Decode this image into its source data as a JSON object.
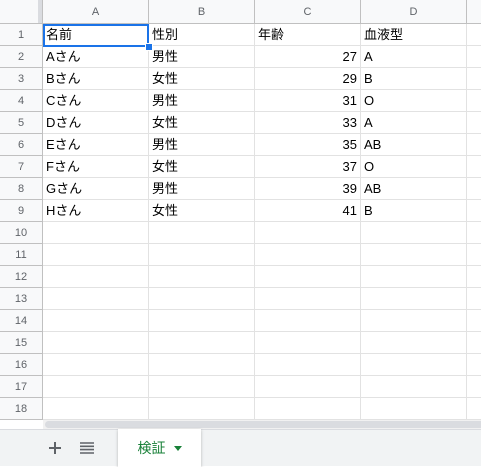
{
  "columns": [
    "A",
    "B",
    "C",
    "D"
  ],
  "rows": [
    "1",
    "2",
    "3",
    "4",
    "5",
    "6",
    "7",
    "8",
    "9",
    "10",
    "11",
    "12",
    "13",
    "14",
    "15",
    "16",
    "17",
    "18"
  ],
  "table": {
    "header": [
      "名前",
      "性別",
      "年齢",
      "血液型"
    ],
    "data": [
      [
        "Aさん",
        "男性",
        "27",
        "A"
      ],
      [
        "Bさん",
        "女性",
        "29",
        "B"
      ],
      [
        "Cさん",
        "男性",
        "31",
        "O"
      ],
      [
        "Dさん",
        "女性",
        "33",
        "A"
      ],
      [
        "Eさん",
        "男性",
        "35",
        "AB"
      ],
      [
        "Fさん",
        "女性",
        "37",
        "O"
      ],
      [
        "Gさん",
        "男性",
        "39",
        "AB"
      ],
      [
        "Hさん",
        "女性",
        "41",
        "B"
      ]
    ]
  },
  "selected_cell": "A1",
  "sheet_tabs": [
    {
      "label": "検証",
      "active": true
    }
  ],
  "icons": {
    "add_sheet": "plus-icon",
    "all_sheets": "list-icon",
    "tab_menu": "triangle-down-icon"
  },
  "colors": {
    "accent": "#1a73e8",
    "tab_text": "#188038"
  }
}
